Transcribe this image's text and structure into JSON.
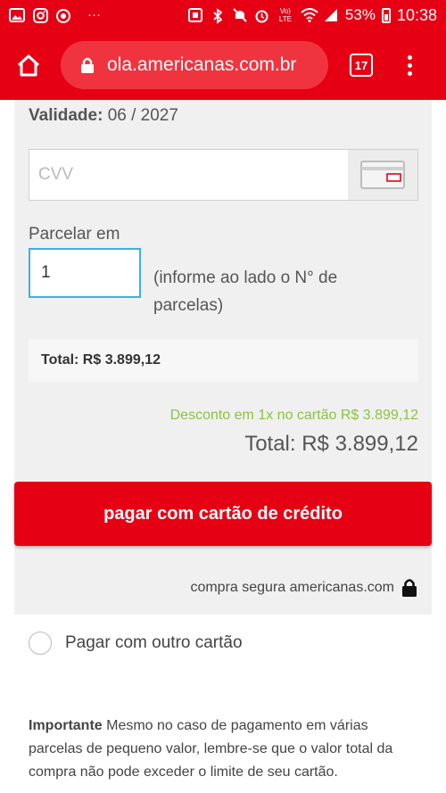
{
  "status_bar": {
    "battery": "53%",
    "time": "10:38",
    "network_label": "Vo) LTE",
    "left_icons": [
      "image-icon",
      "instagram-icon",
      "whatsapp-icon"
    ],
    "overflow": "···"
  },
  "browser": {
    "url": "ola.americanas.com.br",
    "tab_count": "17",
    "theme_color": "#e60014"
  },
  "payment": {
    "validade_label": "Validade:",
    "validade_value": "06 / 2027",
    "cvv_placeholder": "CVV",
    "parcelar_label": "Parcelar em",
    "parcelas_value": "1",
    "parcelas_hint": "(informe ao lado o N° de parcelas)",
    "total_box": "Total: R$ 3.899,12",
    "desconto": "Desconto em 1x no cartão R$ 3.899,12",
    "total_big": "Total: R$ 3.899,12",
    "pay_button": "pagar com cartão de crédito",
    "secure_text": "compra segura americanas.com"
  },
  "other_card": {
    "label": "Pagar com outro cartão"
  },
  "notice": {
    "title": "Importante",
    "text": "Mesmo no caso de pagamento em várias parcelas de pequeno valor, lembre-se que o valor total da compra não pode exceder o limite de seu cartão."
  }
}
